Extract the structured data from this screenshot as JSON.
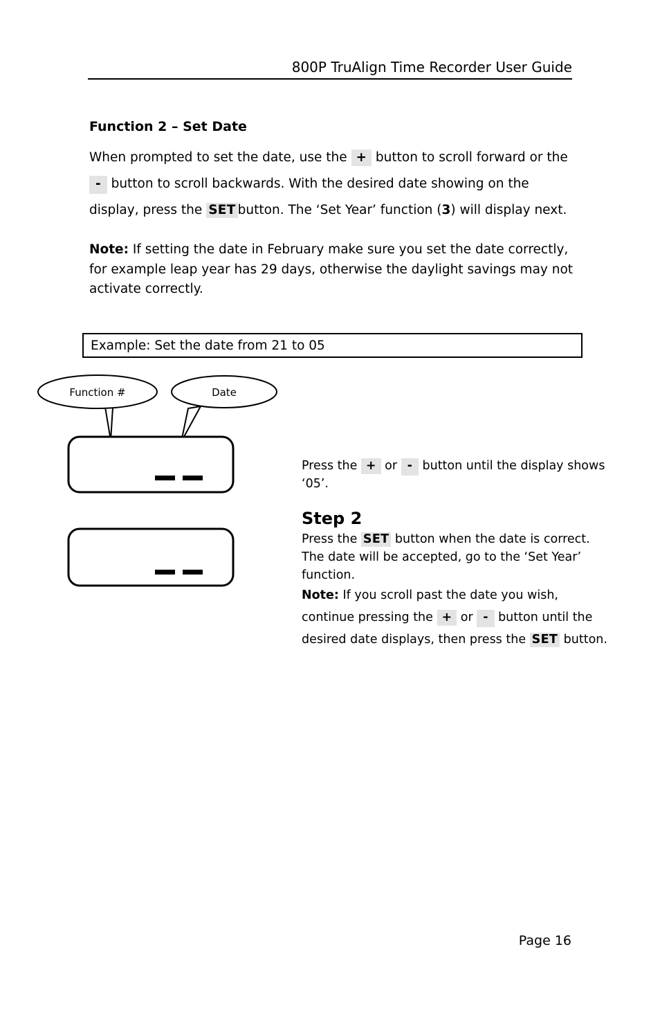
{
  "header": {
    "title": "800P TruAlign Time Recorder User Guide"
  },
  "section": {
    "title": "Function 2 – Set Date",
    "intro": {
      "part1": "When prompted to set the date, use the",
      "chip_plus": "+",
      "part2": "button to scroll forward or the",
      "chip_minus": "-",
      "part3": "button to scroll backwards. With the desired date showing on the display, press the",
      "chip_set": "SET",
      "part4": "button. The ‘Set Year’ function (",
      "function_number": "3",
      "part5": ") will display next."
    },
    "note": {
      "label": "Note:",
      "text": "If setting the date in February make sure you set the date correctly, for example leap year has 29 days, otherwise the daylight savings may not activate correctly."
    }
  },
  "example": {
    "text": "Example: Set the date from 21 to 05"
  },
  "diagram": {
    "callouts": [
      {
        "label": "Function #"
      },
      {
        "label": "Date"
      }
    ],
    "displays": [
      {
        "segments": [
          "—",
          "—"
        ]
      },
      {
        "segments": [
          "—",
          "—"
        ]
      }
    ]
  },
  "instructions": {
    "step1": {
      "part1": "Press the",
      "chip_plus": "+",
      "part2": "or",
      "chip_minus": "-",
      "part3": "button until the display shows ‘05’."
    },
    "step2": {
      "heading": "Step 2",
      "part1": "Press the",
      "chip_set": "SET",
      "part2": "button when the date is correct. The date will be accepted, go to the ‘Set Year’ function."
    },
    "note": {
      "label": "Note:",
      "part1": "If you scroll past the date you wish, continue pressing the",
      "chip_plus": "+",
      "part2": "or",
      "chip_minus": "-",
      "part3": "button until the desired date displays, then press the",
      "chip_set": "SET",
      "part4": "button."
    }
  },
  "footer": {
    "page_label": "Page 16"
  },
  "colors": {
    "chip_background": "#e3e3e3",
    "ink": "#000000",
    "paper": "#ffffff"
  }
}
